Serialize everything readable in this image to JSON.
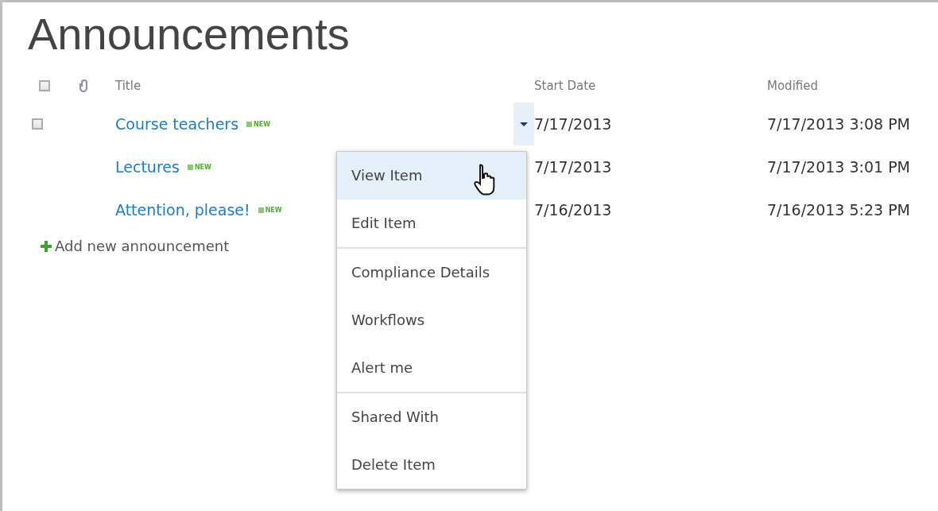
{
  "title": "Announcements",
  "columns": [
    {
      "kind": "select",
      "checked": false
    },
    {
      "kind": "attachment"
    },
    {
      "kind": "text",
      "label": "Title"
    },
    {
      "kind": "text",
      "label": "Start Date"
    },
    {
      "kind": "text",
      "label": "Modified"
    }
  ],
  "rows": [
    {
      "title_parts": [
        {
          "kind": "link",
          "text": "Course teachers"
        },
        {
          "kind": "badge",
          "text": "NEW"
        }
      ],
      "start_date": "7/17/2013",
      "modified": "7/17/2013 3:08 PM",
      "hovered": true
    },
    {
      "title_parts": [
        {
          "kind": "link",
          "text": "Lectures"
        },
        {
          "kind": "badge",
          "text": "NEW"
        }
      ],
      "start_date": "7/17/2013",
      "modified": "7/17/2013 3:01 PM",
      "hovered": false
    },
    {
      "title_parts": [
        {
          "kind": "link",
          "text": "Attention, please!"
        },
        {
          "kind": "badge",
          "text": "NEW"
        }
      ],
      "start_date": "7/16/2013",
      "modified": "7/16/2013 5:23 PM",
      "hovered": false
    }
  ],
  "add_link": "Add new announcement",
  "menu": {
    "groups": [
      [
        {
          "label": "View Item",
          "hovered": true
        },
        {
          "label": "Edit Item",
          "hovered": false
        }
      ],
      [
        {
          "label": "Compliance Details",
          "hovered": false
        },
        {
          "label": "Workflows",
          "hovered": false
        },
        {
          "label": "Alert me",
          "hovered": false
        }
      ],
      [
        {
          "label": "Shared With",
          "hovered": false
        },
        {
          "label": "Delete Item",
          "hovered": false
        }
      ]
    ]
  }
}
